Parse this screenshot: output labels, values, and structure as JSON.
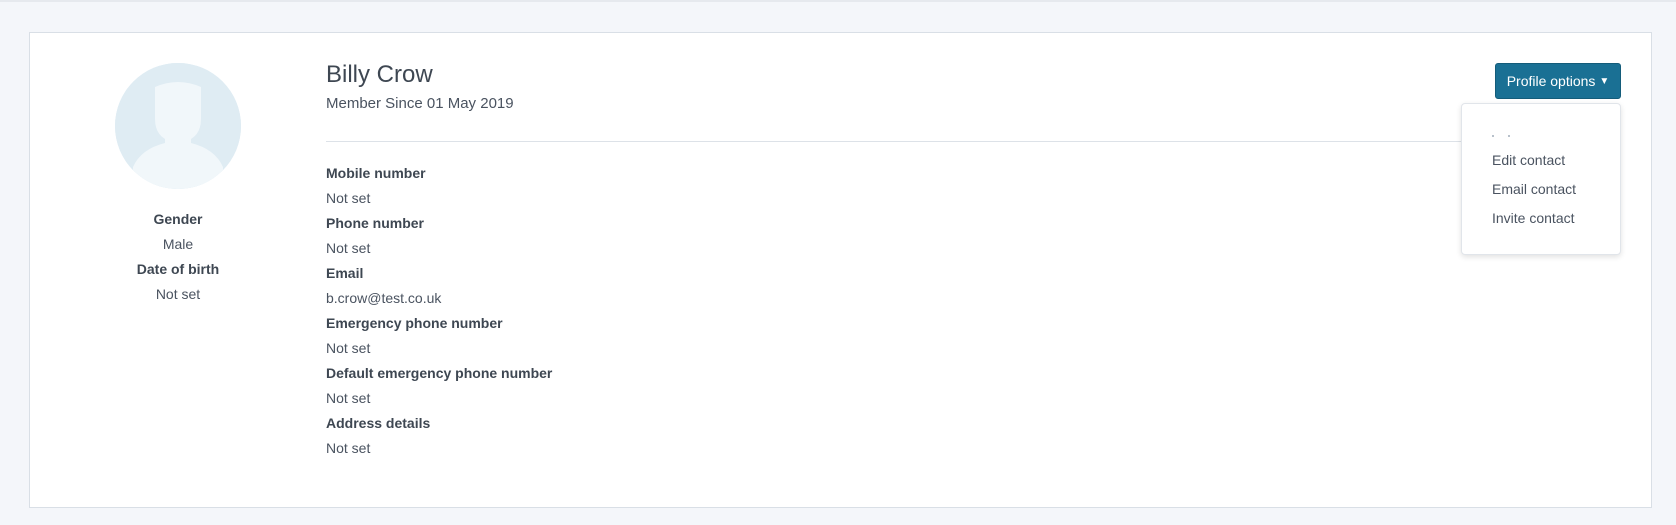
{
  "profile": {
    "name": "Billy Crow",
    "member_since": "Member Since 01 May 2019"
  },
  "left": {
    "gender_label": "Gender",
    "gender_value": "Male",
    "dob_label": "Date of birth",
    "dob_value": "Not set"
  },
  "fields": [
    {
      "label": "Mobile number",
      "value": "Not set"
    },
    {
      "label": "Phone number",
      "value": "Not set"
    },
    {
      "label": "Email",
      "value": "b.crow@test.co.uk"
    },
    {
      "label": "Emergency phone number",
      "value": "Not set"
    },
    {
      "label": "Default emergency phone number",
      "value": "Not set"
    },
    {
      "label": "Address details",
      "value": "Not set"
    }
  ],
  "options": {
    "button_label": "Profile options",
    "chevron_icon": "chevron-down-icon",
    "menu": [
      {
        "label": "Edit contact"
      },
      {
        "label": "Email contact"
      },
      {
        "label": "Invite contact"
      }
    ]
  },
  "colors": {
    "accent": "#1a7094",
    "page_bg": "#f4f6fa",
    "card_bg": "#ffffff",
    "avatar_bg": "#dfecf3"
  }
}
